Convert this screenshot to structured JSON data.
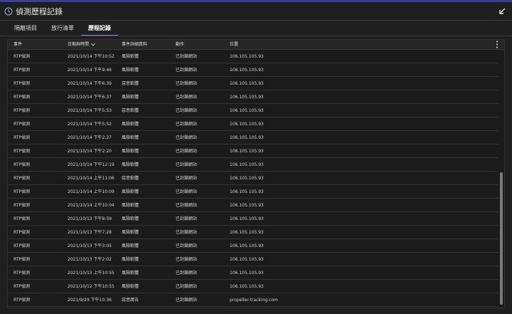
{
  "window": {
    "title": "偵測歷程記錄"
  },
  "tabs": [
    {
      "label": "隔離項目",
      "active": false
    },
    {
      "label": "放行清單",
      "active": false
    },
    {
      "label": "歷程記錄",
      "active": true
    }
  ],
  "table": {
    "headers": {
      "event": "事件",
      "datetime": "日期與時間",
      "detail": "事件詳細資料",
      "action": "動作",
      "location": "位置"
    },
    "rows": [
      {
        "event": "RTP偵測",
        "datetime": "2021/10/14 下午10:52",
        "detail": "風險軟體",
        "action": "已封鎖網站",
        "location": "106.105.105.93"
      },
      {
        "event": "RTP偵測",
        "datetime": "2021/10/14 下午9:46",
        "detail": "風險軟體",
        "action": "已封鎖網站",
        "location": "106.105.105.93"
      },
      {
        "event": "RTP偵測",
        "datetime": "2021/10/14 下午6:39",
        "detail": "惡意軟體",
        "action": "已封鎖網站",
        "location": "106.105.105.93"
      },
      {
        "event": "RTP偵測",
        "datetime": "2021/10/14 下午6:37",
        "detail": "風險軟體",
        "action": "已封鎖網站",
        "location": "106.105.105.93"
      },
      {
        "event": "RTP偵測",
        "datetime": "2021/10/14 下午5:53",
        "detail": "惡意軟體",
        "action": "已封鎖網站",
        "location": "106.105.105.93"
      },
      {
        "event": "RTP偵測",
        "datetime": "2021/10/14 下午5:52",
        "detail": "風險軟體",
        "action": "已封鎖網站",
        "location": "106.105.105.93"
      },
      {
        "event": "RTP偵測",
        "datetime": "2021/10/14 下午2:27",
        "detail": "風險軟體",
        "action": "已封鎖網站",
        "location": "106.105.105.93"
      },
      {
        "event": "RTP偵測",
        "datetime": "2021/10/14 下午2:20",
        "detail": "風險軟體",
        "action": "已封鎖網站",
        "location": "106.105.105.93"
      },
      {
        "event": "RTP偵測",
        "datetime": "2021/10/14 下午12:19",
        "detail": "風險軟體",
        "action": "已封鎖網站",
        "location": "106.105.105.93"
      },
      {
        "event": "RTP偵測",
        "datetime": "2021/10/14 上午11:06",
        "detail": "惡意軟體",
        "action": "已封鎖網站",
        "location": "106.105.105.93"
      },
      {
        "event": "RTP偵測",
        "datetime": "2021/10/14 上午10:09",
        "detail": "風險軟體",
        "action": "已封鎖網站",
        "location": "106.105.105.93"
      },
      {
        "event": "RTP偵測",
        "datetime": "2021/10/14 上午10:04",
        "detail": "風險軟體",
        "action": "已封鎖網站",
        "location": "106.105.105.93"
      },
      {
        "event": "RTP偵測",
        "datetime": "2021/10/13 下午8:59",
        "detail": "風險軟體",
        "action": "已封鎖網站",
        "location": "106.105.105.93"
      },
      {
        "event": "RTP偵測",
        "datetime": "2021/10/13 下午7:28",
        "detail": "風險軟體",
        "action": "已封鎖網站",
        "location": "106.105.105.93"
      },
      {
        "event": "RTP偵測",
        "datetime": "2021/10/13 下午3:05",
        "detail": "風險軟體",
        "action": "已封鎖網站",
        "location": "106.105.105.93"
      },
      {
        "event": "RTP偵測",
        "datetime": "2021/10/13 下午2:02",
        "detail": "風險軟體",
        "action": "已封鎖網站",
        "location": "106.105.105.93"
      },
      {
        "event": "RTP偵測",
        "datetime": "2021/10/13 上午10:55",
        "detail": "風險軟體",
        "action": "已封鎖網站",
        "location": "106.105.105.93"
      },
      {
        "event": "RTP偵測",
        "datetime": "2021/10/12 下午10:55",
        "detail": "風險軟體",
        "action": "已封鎖網站",
        "location": "106.105.105.93"
      },
      {
        "event": "RTP偵測",
        "datetime": "2021/9/29 下午10:36",
        "detail": "惡意廣告",
        "action": "已封鎖網站",
        "location": "propeller-tracking.com"
      }
    ]
  },
  "icons": {
    "title": "history-clock-icon",
    "collapse": "collapse-arrow-icon",
    "menu": "more-vertical-icon",
    "sort": "chevron-down-icon"
  },
  "colors": {
    "accent": "#6f8ff6",
    "top_border": "#3a3aa8",
    "background": "#1f1f1f"
  }
}
